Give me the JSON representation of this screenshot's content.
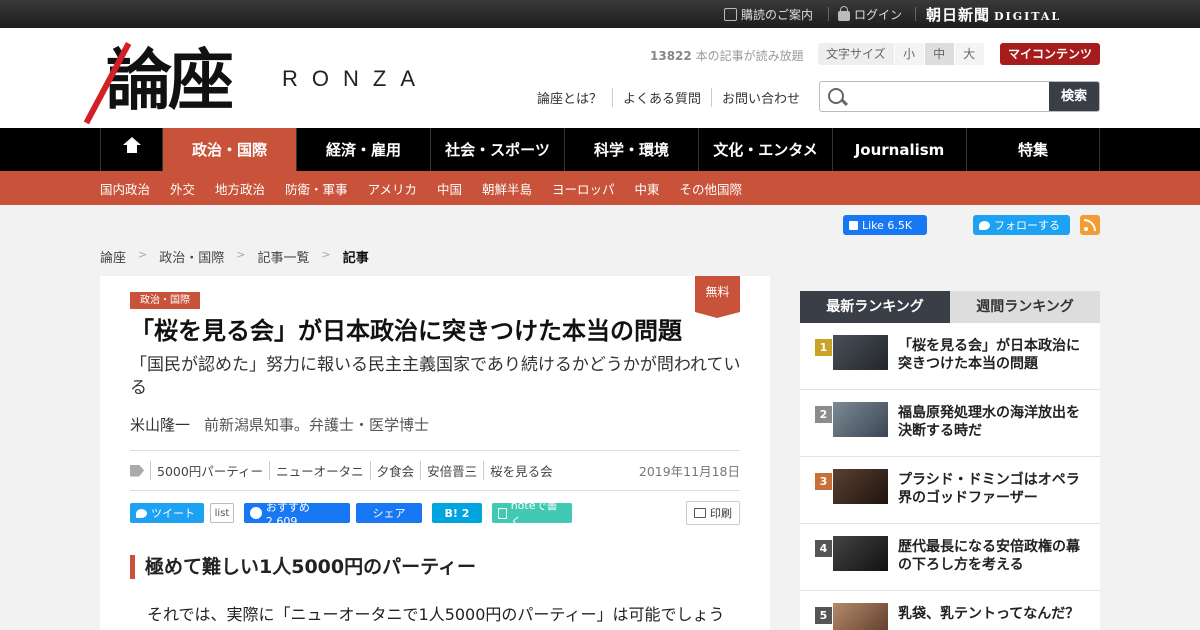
{
  "topbar": {
    "subscribe": "購読のご案内",
    "login": "ログイン",
    "brand": "朝日新聞",
    "brand_sub": "DIGITAL"
  },
  "header": {
    "logo": "論座",
    "logo_latin": "RONZA",
    "read_count": "13822",
    "read_count_suffix": " 本の記事が読み放題",
    "font_size_label": "文字サイズ",
    "font_sizes": [
      "小",
      "中",
      "大"
    ],
    "my_contents": "マイコンテンツ",
    "links": [
      "論座とは？",
      "よくある質問",
      "お問い合わせ"
    ],
    "search_placeholder": "",
    "search_button": "検索"
  },
  "nav": {
    "items": [
      "政治・国際",
      "経済・雇用",
      "社会・スポーツ",
      "科学・環境",
      "文化・エンタメ",
      "Journalism",
      "特集"
    ]
  },
  "subnav": {
    "items": [
      "国内政治",
      "外交",
      "地方政治",
      "防衛・軍事",
      "アメリカ",
      "中国",
      "朝鮮半島",
      "ヨーロッパ",
      "中東",
      "その他国際"
    ]
  },
  "social": {
    "fb_like": "Like 6.5K",
    "tw_follow": "フォローする"
  },
  "breadcrumb": {
    "items": [
      "論座",
      "政治・国際",
      "記事一覧"
    ],
    "current": "記事",
    "separator": ">"
  },
  "article": {
    "category": "政治・国際",
    "free": "無料",
    "title": "「桜を見る会」が日本政治に突きつけた本当の問題",
    "subtitle": "「国民が認めた」努力に報いる民主主義国家であり続けるかどうかが問われている",
    "author": "米山隆一",
    "author_role": "前新潟県知事。弁護士・医学博士",
    "tags": [
      "5000円パーティー",
      "ニューオータニ",
      "夕食会",
      "安倍晋三",
      "桜を見る会"
    ],
    "date": "2019年11月18日",
    "share": {
      "tweet": "ツイート",
      "list": "list",
      "fb_recommend": "おすすめ 2,609",
      "fb_share": "シェア",
      "hatena": "B! 2",
      "note": "noteで書く",
      "print": "印刷"
    },
    "section_heading": "極めて難しい1人5000円のパーティー",
    "body": "それでは、実際に「ニューオータニで1人5000円のパーティー」は可能でしょう"
  },
  "ranking": {
    "tab_latest": "最新ランキング",
    "tab_weekly": "週間ランキング",
    "items": [
      {
        "rank": "1",
        "title": "「桜を見る会」が日本政治に突きつけた本当の問題",
        "color": "#c9a227"
      },
      {
        "rank": "2",
        "title": "福島原発処理水の海洋放出を決断する時だ",
        "color": "#8c8c8c"
      },
      {
        "rank": "3",
        "title": "プラシド・ドミンゴはオペラ界のゴッドファーザー",
        "color": "#c8703a"
      },
      {
        "rank": "4",
        "title": "歴代最長になる安倍政権の幕の下ろし方を考える",
        "color": "#555555"
      },
      {
        "rank": "5",
        "title": "乳袋、乳テントってなんだ？",
        "color": "#555555"
      }
    ]
  },
  "colors": {
    "accent": "#c8523a",
    "dark": "#3a3f47",
    "my_contents": "#a61c1c"
  }
}
